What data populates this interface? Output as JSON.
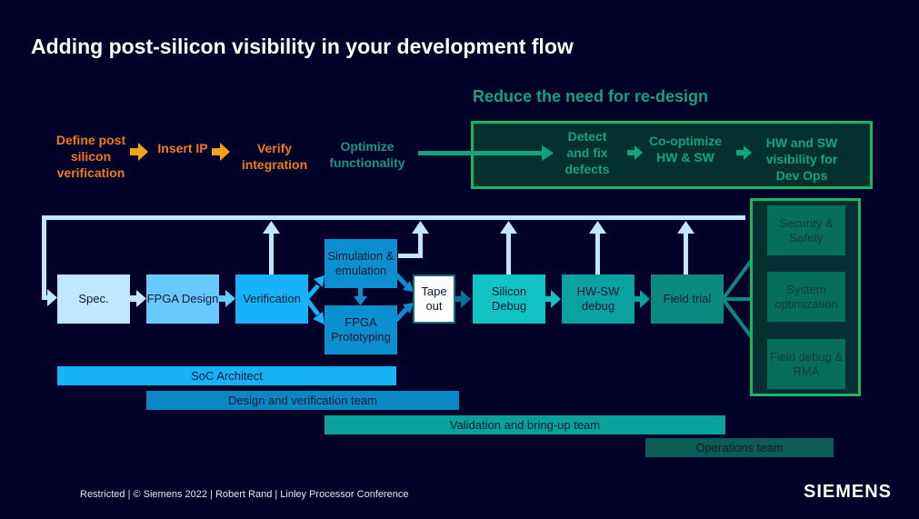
{
  "slide": {
    "title": "Adding post-silicon visibility in your development flow",
    "subtitle": "Reduce the need for re-design"
  },
  "top_flow": {
    "orange_steps": [
      {
        "label": "Define post silicon verification"
      },
      {
        "label": "Insert IP"
      },
      {
        "label": "Verify integration"
      }
    ],
    "teal_step": {
      "label": "Optimize functionality"
    },
    "green_steps": [
      {
        "label": "Detect and fix defects"
      },
      {
        "label": "Co-optimize HW & SW"
      },
      {
        "label": "HW and SW visibility for Dev Ops"
      }
    ]
  },
  "process": {
    "boxes": [
      {
        "label": "Spec.",
        "color": "#bfe7ff"
      },
      {
        "label": "FPGA Design",
        "color": "#68c9ff"
      },
      {
        "label": "Verification",
        "color": "#17b2f8"
      },
      {
        "label": "Simulation & emulation",
        "color": "#0c8fcf"
      },
      {
        "label": "FPGA Prototyping",
        "color": "#0c8fcf"
      },
      {
        "label": "Tape out",
        "color": "#ffffff"
      },
      {
        "label": "Silicon Debug",
        "color": "#12c3c3"
      },
      {
        "label": "HW-SW debug",
        "color": "#0aa1a0"
      },
      {
        "label": "Field trial",
        "color": "#0b8a80"
      }
    ],
    "outcomes": [
      {
        "label": "Security & Safety"
      },
      {
        "label": "System optimization"
      },
      {
        "label": "Field debug & RMA"
      }
    ]
  },
  "teams": [
    {
      "label": "SoC Architect",
      "color": "#17b2f8"
    },
    {
      "label": "Design and verification team",
      "color": "#0a87c4"
    },
    {
      "label": "Validation and bring-up team",
      "color": "#0aa09b"
    },
    {
      "label": "Operations team",
      "color": "#095c57"
    }
  ],
  "footer": {
    "text": "Restricted | © Siemens 2022  | Robert Rand | Linley Processor Conference",
    "logo": "SIEMENS"
  },
  "colors": {
    "background": "#000028",
    "orange": "#f07a1e",
    "green_accent": "#16b864",
    "teal_text": "#10a57d",
    "feedback_line": "#bfe7ff"
  }
}
